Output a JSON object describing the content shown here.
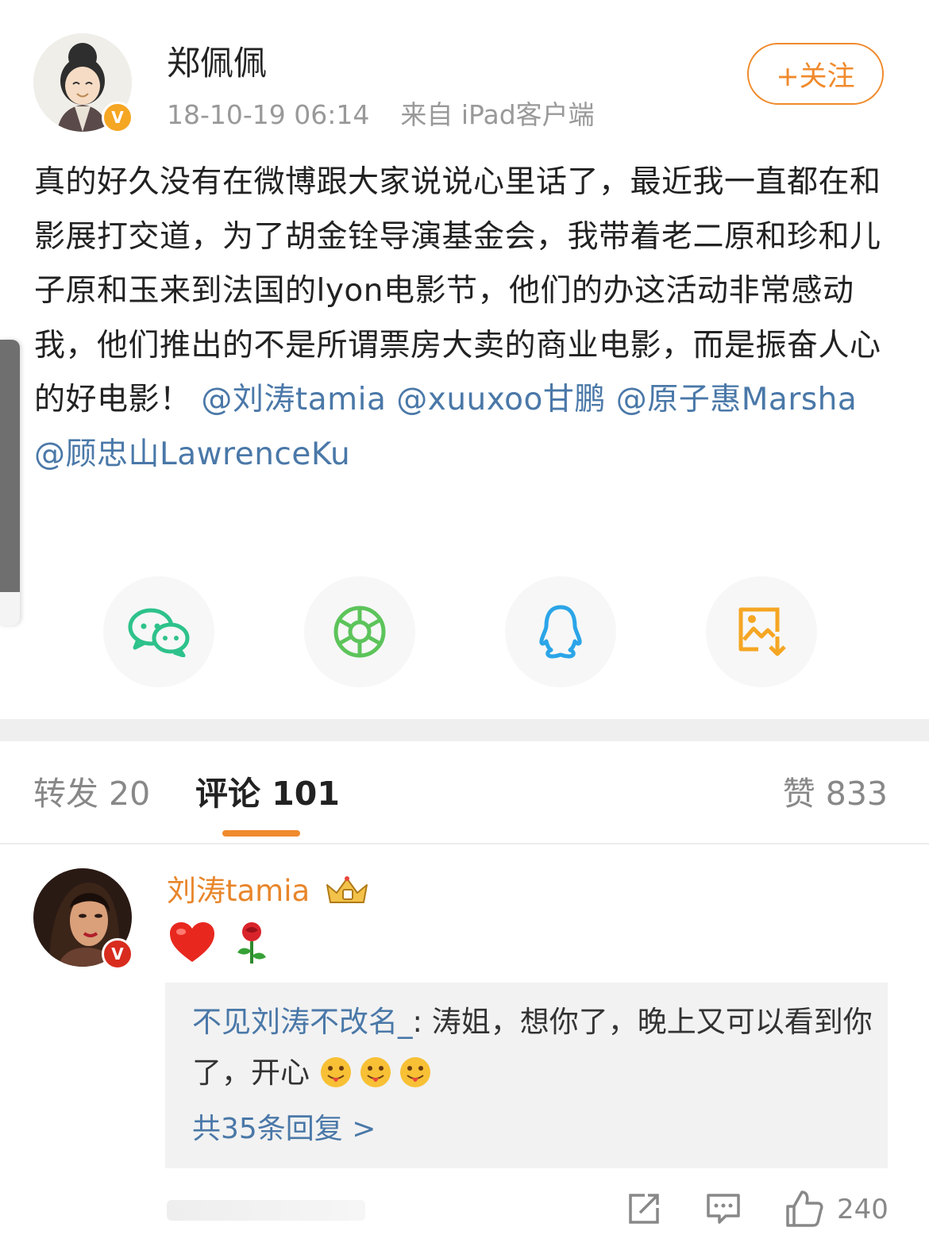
{
  "post": {
    "author_name": "郑佩佩",
    "timestamp": "18-10-19 06:14",
    "source": "来自 iPad客户端",
    "follow_label": "+关注",
    "body_text": "真的好久没有在微博跟大家说说心里话了，最近我一直都在和影展打交道，为了胡金铨导演基金会，我带着老二原和珍和儿子原和玉来到法国的lyon电影节，他们的办这活动非常感动我，他们推出的不是所谓票房大卖的商业电影，而是振奋人心的好电影！",
    "mentions": [
      "@刘涛tamia",
      "@xuuxoo甘鹏",
      "@原子惠Marsha",
      "@顾忠山LawrenceKu"
    ]
  },
  "share": {
    "icons": [
      "wechat-icon",
      "moments-icon",
      "qq-icon",
      "save-image-icon"
    ]
  },
  "tabs": {
    "repost_label": "转发",
    "repost_count": "20",
    "comment_label": "评论",
    "comment_count": "101",
    "like_label": "赞",
    "like_count": "833"
  },
  "comment": {
    "name": "刘涛tamia",
    "emojis": [
      "heart-emoji",
      "rose-emoji"
    ],
    "reply_user": "不见刘涛不改名_",
    "reply_sep": ":",
    "reply_text": "涛姐，想你了，晚上又可以看到你了，开心",
    "reply_emojis": [
      "tongue-emoji",
      "tongue-emoji",
      "tongue-emoji"
    ],
    "reply_count_text": "共35条回复 >",
    "like_count": "240"
  },
  "colors": {
    "accent": "#f08a2c",
    "link": "#4a78a8",
    "verified": "#f5a623",
    "verified_red": "#d82c1e"
  }
}
